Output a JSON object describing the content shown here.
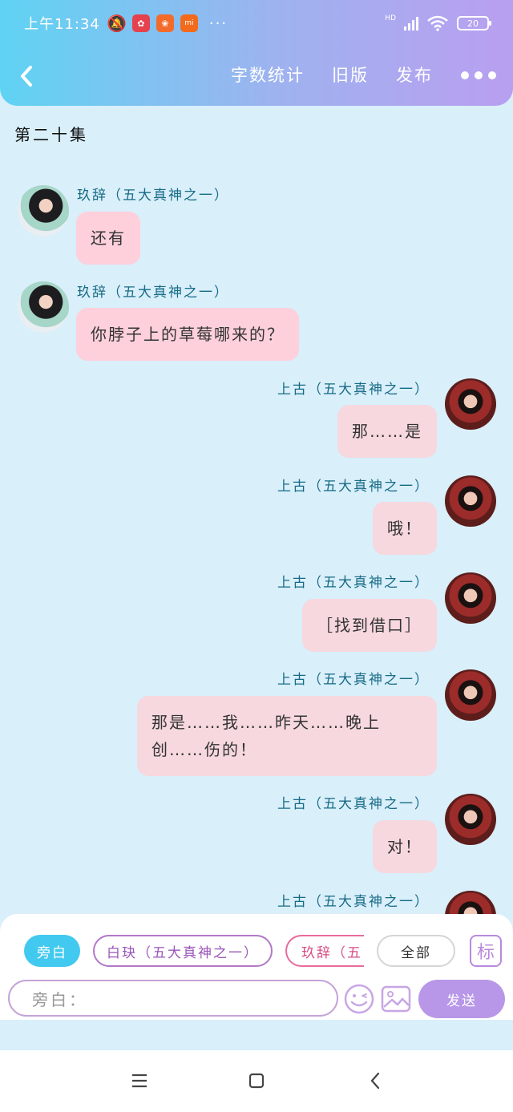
{
  "status_bar": {
    "time": "上午11:34",
    "more_label": "···",
    "network": "HD",
    "battery": "20"
  },
  "header": {
    "back_icon": "chevron-left-icon",
    "actions": [
      "字数统计",
      "旧版",
      "发布"
    ],
    "more_icon": "more-dots-icon"
  },
  "episode_title": "第二十集",
  "messages": [
    {
      "side": "left",
      "name": "玖辞（五大真神之一）",
      "text": "还有"
    },
    {
      "side": "left",
      "name": "玖辞（五大真神之一）",
      "text": "你脖子上的草莓哪来的？"
    },
    {
      "side": "right",
      "name": "上古（五大真神之一）",
      "text": "那……是"
    },
    {
      "side": "right",
      "name": "上古（五大真神之一）",
      "text": "哦！"
    },
    {
      "side": "right",
      "name": "上古（五大真神之一）",
      "text": "［找到借口］"
    },
    {
      "side": "right",
      "name": "上古（五大真神之一）",
      "text": "那是……我……昨天……晚上创……伤的！"
    },
    {
      "side": "right",
      "name": "上古（五大真神之一）",
      "text": "对！"
    },
    {
      "side": "right",
      "name": "上古（五大真神之一）",
      "text": ""
    }
  ],
  "role_chips": {
    "narration": "旁白",
    "baijue": "白玦（五大真神之一）",
    "jiuci": "玖辞（五",
    "all": "全部",
    "mark": "标"
  },
  "composer": {
    "placeholder": "旁白：",
    "send_label": "发送"
  },
  "colors": {
    "header_start": "#5fd3f3",
    "header_end": "#b99ff0",
    "background": "#d9effa",
    "bubble": "#fdd0dc",
    "name_text": "#176b86",
    "send_button": "#b897e8"
  }
}
